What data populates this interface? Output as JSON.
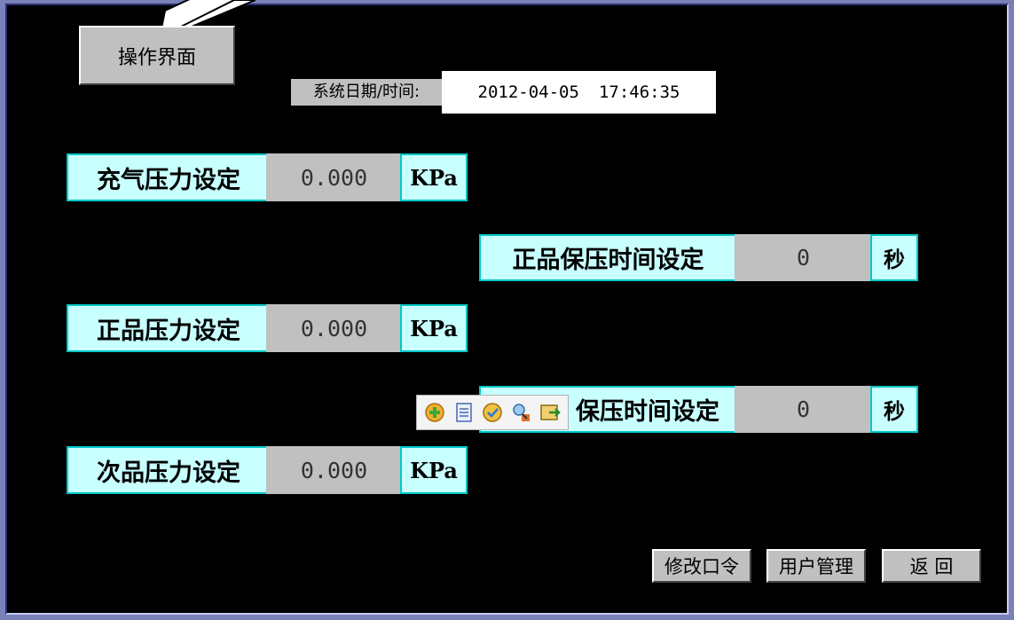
{
  "header": {
    "operation_button": "操作界面",
    "datetime_label": "系统日期/时间:",
    "date": "2012-04-05",
    "time": "17:46:35"
  },
  "settings": {
    "charge_pressure": {
      "label": "充气压力设定",
      "value": "0.000",
      "unit": "KPa"
    },
    "good_pressure": {
      "label": "正品压力设定",
      "value": "0.000",
      "unit": "KPa"
    },
    "reject_pressure": {
      "label": "次品压力设定",
      "value": "0.000",
      "unit": "KPa"
    },
    "good_hold_time": {
      "label": "正品保压时间设定",
      "value": "0",
      "unit": "秒"
    },
    "reject_hold_time": {
      "label_visible": "保压时间设定",
      "value": "0",
      "unit": "秒"
    }
  },
  "footer": {
    "change_password": "修改口令",
    "user_management": "用户管理",
    "back": "返 回"
  },
  "toolbar": {
    "icons": [
      "add-icon",
      "save-icon",
      "tag-icon",
      "search-user-icon",
      "export-icon"
    ]
  },
  "colors": {
    "background": "#000000",
    "label_fill": "#c8ffff",
    "label_border": "#00c8c8",
    "value_fill": "#c0c0c0",
    "frame": "#7a80b8"
  }
}
